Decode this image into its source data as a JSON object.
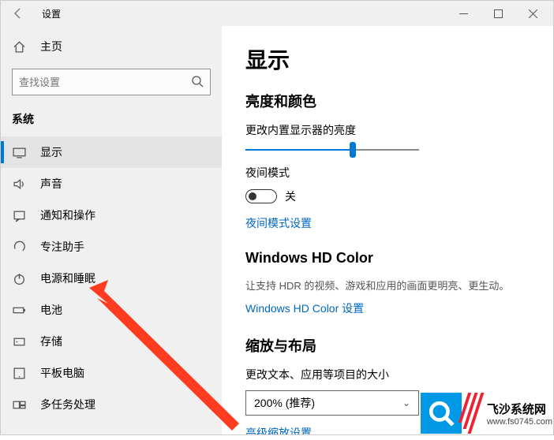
{
  "window": {
    "title": "设置"
  },
  "sidebar": {
    "home": "主页",
    "search_placeholder": "查找设置",
    "section": "系统",
    "items": [
      {
        "label": "显示"
      },
      {
        "label": "声音"
      },
      {
        "label": "通知和操作"
      },
      {
        "label": "专注助手"
      },
      {
        "label": "电源和睡眠"
      },
      {
        "label": "电池"
      },
      {
        "label": "存储"
      },
      {
        "label": "平板电脑"
      },
      {
        "label": "多任务处理"
      }
    ]
  },
  "main": {
    "title": "显示",
    "brightness": {
      "heading": "亮度和颜色",
      "label": "更改内置显示器的亮度",
      "value_percent": 62
    },
    "nightlight": {
      "label": "夜间模式",
      "state": "关",
      "settings_link": "夜间模式设置"
    },
    "hdcolor": {
      "heading": "Windows HD Color",
      "desc": "让支持 HDR 的视频、游戏和应用的画面更明亮、更生动。",
      "link": "Windows HD Color 设置"
    },
    "scale": {
      "heading": "缩放与布局",
      "label": "更改文本、应用等项目的大小",
      "value": "200% (推荐)",
      "advanced_link": "高级缩放设置"
    }
  },
  "watermark": {
    "name": "飞沙系统网",
    "url": "www.fs0745.com"
  }
}
